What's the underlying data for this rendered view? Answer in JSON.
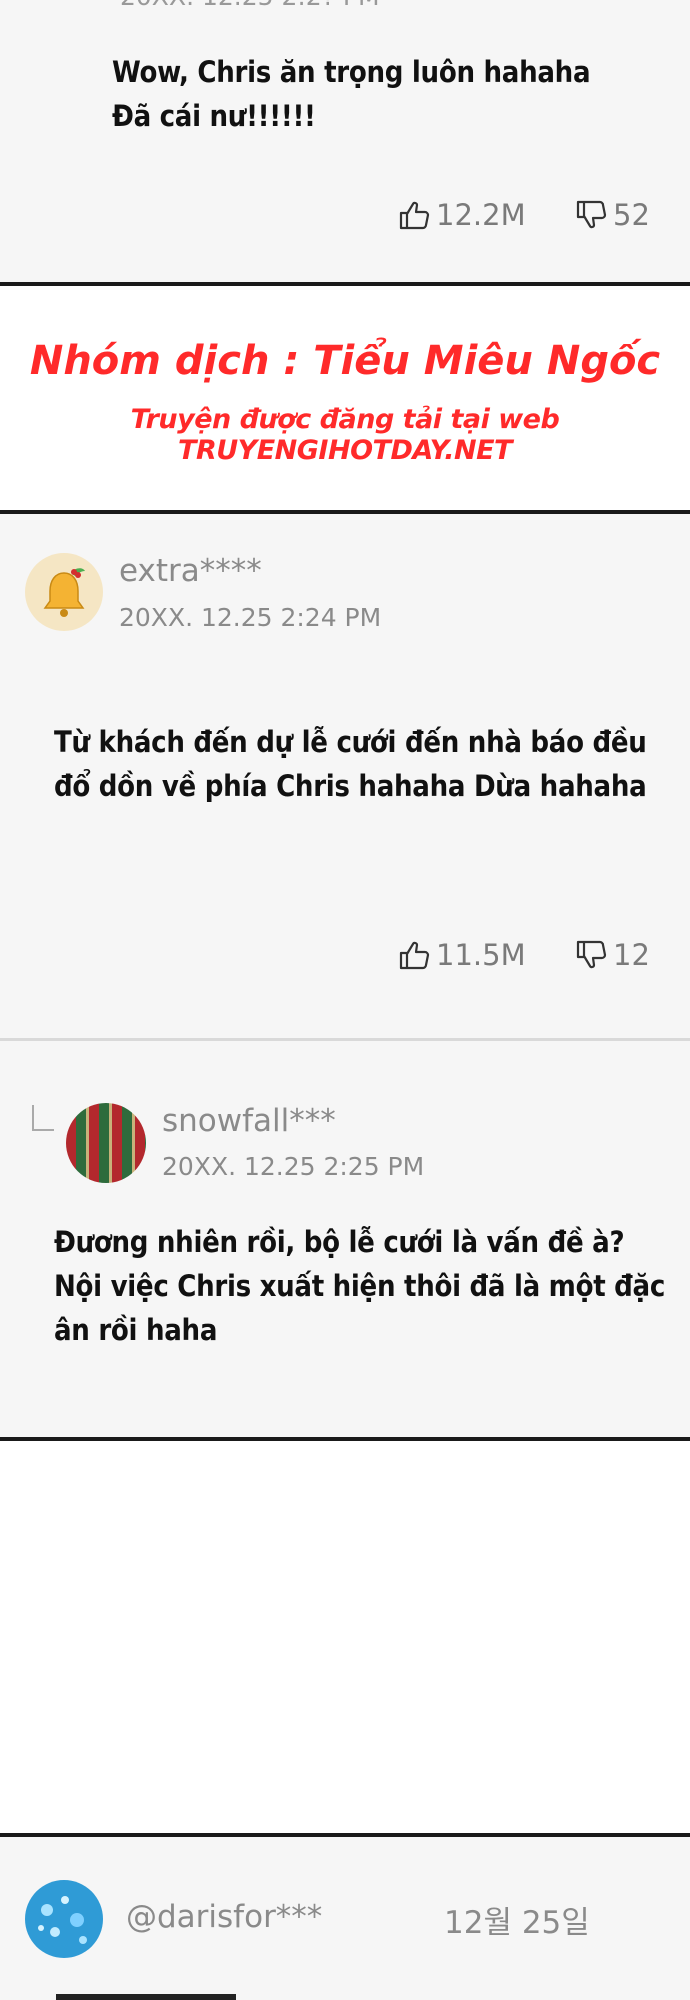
{
  "top_comment": {
    "timestamp_partial": "20XX. 12.25 2:2? PM",
    "text": "Wow, Chris ăn trọng luôn hahaha\nĐã cái nư!!!!!!",
    "likes": "12.2M",
    "dislikes": "52"
  },
  "banner": {
    "line1": "Nhóm dịch : Tiểu Miêu Ngốc",
    "line2": "Truyện được đăng tải tại web TRUYENGIHOTDAY.NET"
  },
  "comment_extra": {
    "username": "extra****",
    "timestamp": "20XX. 12.25  2:24 PM",
    "text": "Từ khách đến dự lễ cưới đến nhà báo đều\nđổ dồn về phía Chris hahaha Dừa hahaha",
    "likes": "11.5M",
    "dislikes": "12"
  },
  "reply_snowfall": {
    "username": "snowfall***",
    "timestamp": "20XX. 12.25  2:25 PM",
    "text": "Đương nhiên rồi, bộ lễ cưới là vấn đề à?\nNội việc Chris xuất hiện thôi đã là một đặc\nân rồi haha"
  },
  "comment_darisfor": {
    "username": "@darisfor***",
    "date": "12월 25일"
  },
  "colors": {
    "card_bg": "#f6f6f6",
    "rule": "#1a1a1a",
    "meta_gray": "#8a8a8a",
    "banner_red": "#ff2a2a"
  },
  "icons": [
    "thumbs-up-icon",
    "thumbs-down-icon",
    "reply-arrow-icon"
  ]
}
